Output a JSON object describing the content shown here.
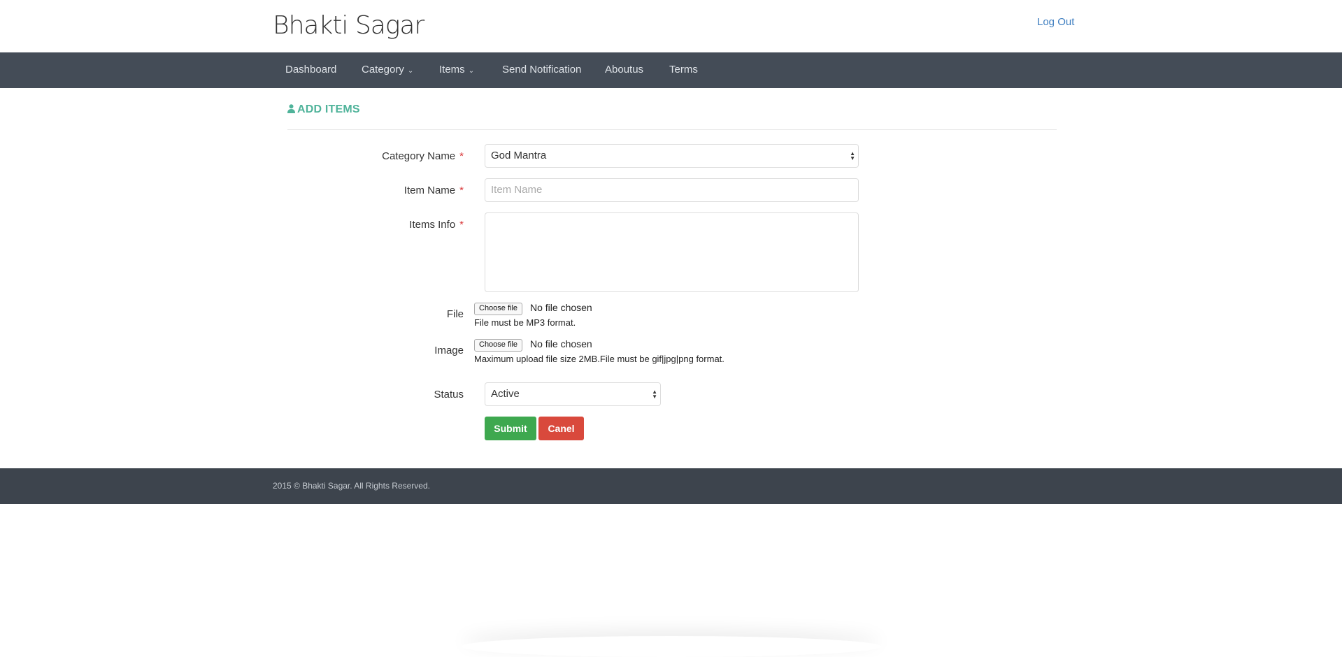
{
  "header": {
    "brand": "Bhakti Sagar",
    "logout": "Log Out"
  },
  "nav": {
    "items": [
      {
        "label": "Dashboard"
      },
      {
        "label": "Category",
        "dropdown": true
      },
      {
        "label": "Items",
        "dropdown": true
      },
      {
        "label": "Send Notification"
      },
      {
        "label": "Aboutus"
      },
      {
        "label": "Terms"
      }
    ]
  },
  "page": {
    "title": "ADD ITEMS",
    "icon": "user-icon"
  },
  "form": {
    "category": {
      "label": "Category Name",
      "value": "God Mantra"
    },
    "item_name": {
      "label": "Item Name",
      "placeholder": "Item Name",
      "value": ""
    },
    "items_info": {
      "label": "Items Info",
      "value": ""
    },
    "file": {
      "label": "File",
      "button": "Choose file",
      "status": "No file chosen",
      "help": "File must be MP3 format."
    },
    "image": {
      "label": "Image",
      "button": "Choose file",
      "status": "No file chosen",
      "help": "Maximum upload file size 2MB.File must be gif|jpg|png format."
    },
    "status": {
      "label": "Status",
      "value": "Active"
    },
    "required_mark": "*",
    "submit": "Submit",
    "cancel": "Canel"
  },
  "colors": {
    "nav": "#444c57",
    "footer": "#3d444d",
    "accent": "#4fb39a",
    "submit": "#3ea84f",
    "cancel": "#d9493c",
    "link": "#3e7ec0"
  },
  "footer": {
    "copyright": "2015 © Bhakti Sagar. All Rights Reserved."
  }
}
